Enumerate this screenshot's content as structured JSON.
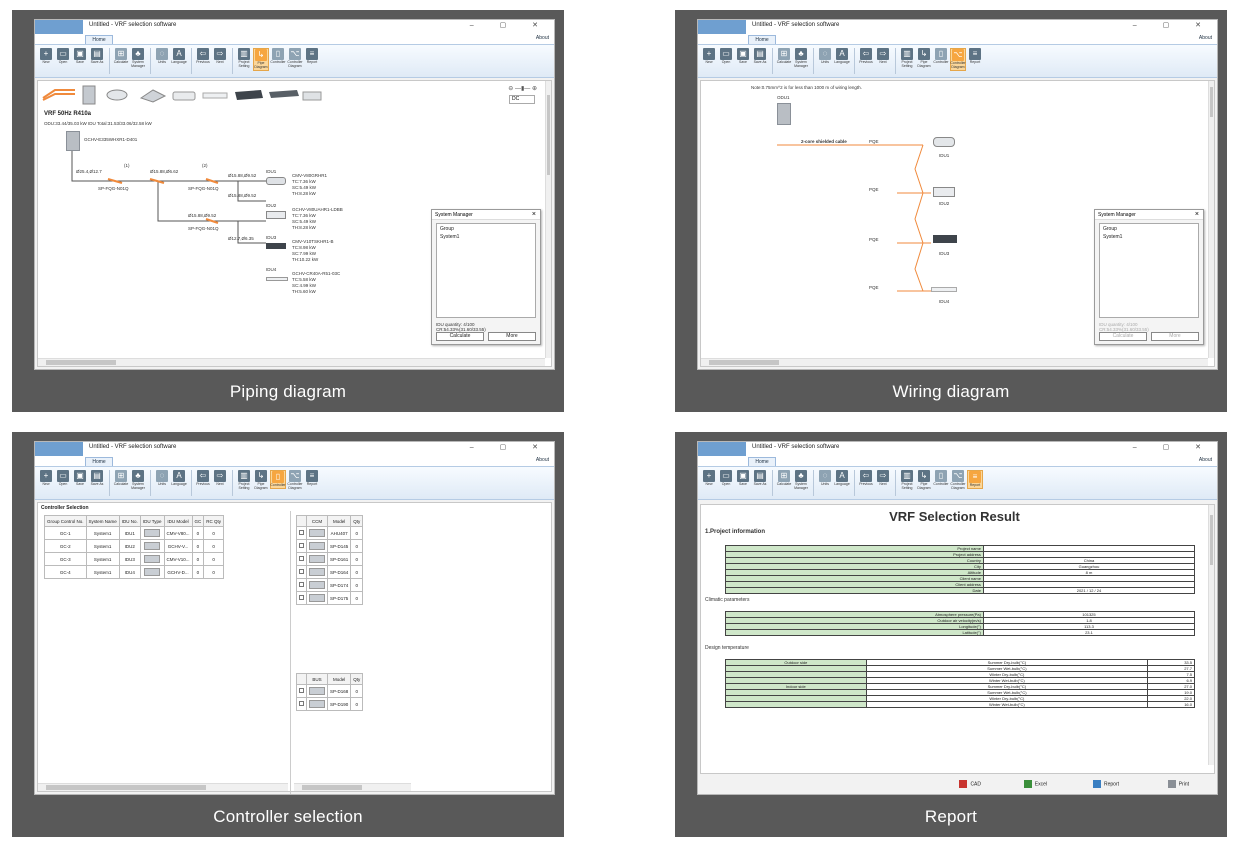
{
  "panels": {
    "piping": {
      "caption": "Piping diagram",
      "title": "Untitled - VRF selection software",
      "tab": "Home",
      "about": "About",
      "system_label": "VRF 50Hz R410a",
      "odu_line": "ODU:33.44/35.03 kW    IDU Total:31.53/33.06/32.58 kW",
      "odu_model": "GCHV-E335WHXR1-D401",
      "pipe_labels": [
        "Ø25.4,Ø12.7",
        "(1)",
        "Ø15.88,Ø6.62",
        "(2)",
        "Ø15.88,Ø9.52",
        "Ø15.88,Ø9.52",
        "Ø15.88,Ø9.52",
        "Ø12.7,Ø6.35",
        "SP-FQG-N01Q",
        "SP-FQG-N01Q",
        "SP-FQG-N01Q"
      ],
      "idus": [
        {
          "name": "IDU1",
          "model": "CMV-V80GRHR1",
          "tc": "TC:7.36 kW",
          "sc": "SC:5.49 kW",
          "th": "TH:8.28 kW"
        },
        {
          "name": "IDU2",
          "model": "GCHV-V80UAHR1-LDBB",
          "tc": "TC:7.36 kW",
          "sc": "SC:5.49 kW",
          "th": "TH:8.28 kW"
        },
        {
          "name": "IDU3",
          "model": "CMV-V10TSKHR1-B",
          "tc": "TC:8.98 kW",
          "sc": "SC:7.99 kW",
          "th": "TH:10.22 kW"
        },
        {
          "name": "IDU4",
          "model": "GCHV-CR40A-R51-03C",
          "tc": "TC:5.58 kW",
          "sc": "SC:4.99 kW",
          "th": "TH:5.60 kW"
        }
      ],
      "zoom": "DC",
      "system_manager": {
        "title": "System Manager",
        "group": "Group",
        "system": "System1",
        "qty": "IDU quantity: 4/100",
        "cr": "CR:54.33%(31.60/33.55)",
        "calculate": "Calculate",
        "more": "More"
      }
    },
    "wiring": {
      "caption": "Wiring diagram",
      "note": "Note:0.75mm^2 is for less than 1000 m of wiring length.",
      "odu_label": "ODU1",
      "cable_label": "2-core shielded cable",
      "pqe": [
        "PQE",
        "PQE",
        "PQE",
        "PQE"
      ],
      "idus": [
        "IDU1",
        "IDU2",
        "IDU3",
        "IDU4"
      ]
    },
    "controller": {
      "caption": "Controller selection",
      "section_title": "Controller Selection",
      "headers": [
        "Group Control No.",
        "System Name",
        "IDU No.",
        "IDU Type",
        "IDU Model",
        "GC",
        "RC Qty"
      ],
      "rows": [
        [
          "GC-1",
          "System1",
          "IDU1",
          "",
          "CMV-V80...",
          "0",
          "0"
        ],
        [
          "GC-2",
          "System1",
          "IDU2",
          "",
          "GCHV-V...",
          "0",
          "0"
        ],
        [
          "GC-3",
          "System1",
          "IDU3",
          "",
          "CMV-V10...",
          "0",
          "0"
        ],
        [
          "GC-4",
          "System1",
          "IDU4",
          "",
          "GCHV-D...",
          "0",
          "0"
        ]
      ],
      "ccm_headers": [
        "",
        "CCM",
        "Model",
        "Qty"
      ],
      "ccm_rows": [
        [
          "AHU407",
          "0"
        ],
        [
          "SP-D145",
          "0"
        ],
        [
          "SP-D161",
          "0"
        ],
        [
          "SP-D164",
          "0"
        ],
        [
          "SP-D174",
          "0"
        ],
        [
          "SP-D175",
          "0"
        ]
      ],
      "bus_headers": [
        "",
        "BUS",
        "Model",
        "Qty"
      ],
      "bus_rows": [
        [
          "SP-D168",
          "0"
        ],
        [
          "SP-D190",
          "0"
        ]
      ]
    },
    "report": {
      "caption": "Report",
      "heading": "VRF Selection Result",
      "section1": "1.Project information",
      "project_rows": [
        [
          "Project name",
          ""
        ],
        [
          "Project address",
          ""
        ],
        [
          "Country",
          "China"
        ],
        [
          "City",
          "Guangzhou"
        ],
        [
          "Altitude",
          "8 m"
        ],
        [
          "Client name",
          ""
        ],
        [
          "Client address",
          ""
        ],
        [
          "Date",
          "2021 / 12 / 24"
        ]
      ],
      "climatic_title": "Climatic parameters",
      "climatic_rows": [
        [
          "Atmosphere pressure(Pa)",
          "101325"
        ],
        [
          "Outdoor air velocity(m/s)",
          "1.8"
        ],
        [
          "Longitude(°)",
          "113.3"
        ],
        [
          "Latitude(°)",
          "23.1"
        ]
      ],
      "design_title": "Design temperature",
      "design_rows": [
        [
          "Outdoor side",
          "Summer Dry-bulb(°C)",
          "33.5"
        ],
        [
          "",
          "Summer Wet-bulb(°C)",
          "27.7"
        ],
        [
          "",
          "Winter Dry-bulb(°C)",
          "7.5"
        ],
        [
          "",
          "Winter Wet-bulb(°C)",
          "6.9"
        ],
        [
          "Indoor side",
          "Summer Dry-bulb(°C)",
          "27.0"
        ],
        [
          "",
          "Summer Wet-bulb(°C)",
          "19.0"
        ],
        [
          "",
          "Winter Dry-bulb(°C)",
          "22.0"
        ],
        [
          "",
          "Winter Wet-bulb(°C)",
          "16.0"
        ]
      ],
      "export": {
        "cad": "CAD",
        "excel": "Excel",
        "report": "Report",
        "print": "Print"
      }
    }
  },
  "ribbon": {
    "buttons": [
      {
        "label": "New",
        "glyph": "+"
      },
      {
        "label": "Open",
        "glyph": "▭"
      },
      {
        "label": "Save",
        "glyph": "▣"
      },
      {
        "label": "Save As",
        "glyph": "▤"
      },
      {
        "label": "Calculate",
        "glyph": "⊞"
      },
      {
        "label": "System Manager",
        "glyph": "♣"
      },
      {
        "label": "Units",
        "glyph": "◌"
      },
      {
        "label": "Language",
        "glyph": "A"
      },
      {
        "label": "Previous",
        "glyph": "⇦"
      },
      {
        "label": "Next",
        "glyph": "⇨"
      },
      {
        "label": "Project Setting",
        "glyph": "▥"
      },
      {
        "label": "Pipe Diagram",
        "glyph": "↳"
      },
      {
        "label": "Controller",
        "glyph": "▯"
      },
      {
        "label": "Controller Diagram",
        "glyph": "⌥"
      },
      {
        "label": "Report",
        "glyph": "≡"
      }
    ]
  },
  "colors": {
    "background": "#595959",
    "ribbon_active": "#f6a640",
    "pipe": "#f08a3c",
    "report_green": "#cfe7c9"
  }
}
